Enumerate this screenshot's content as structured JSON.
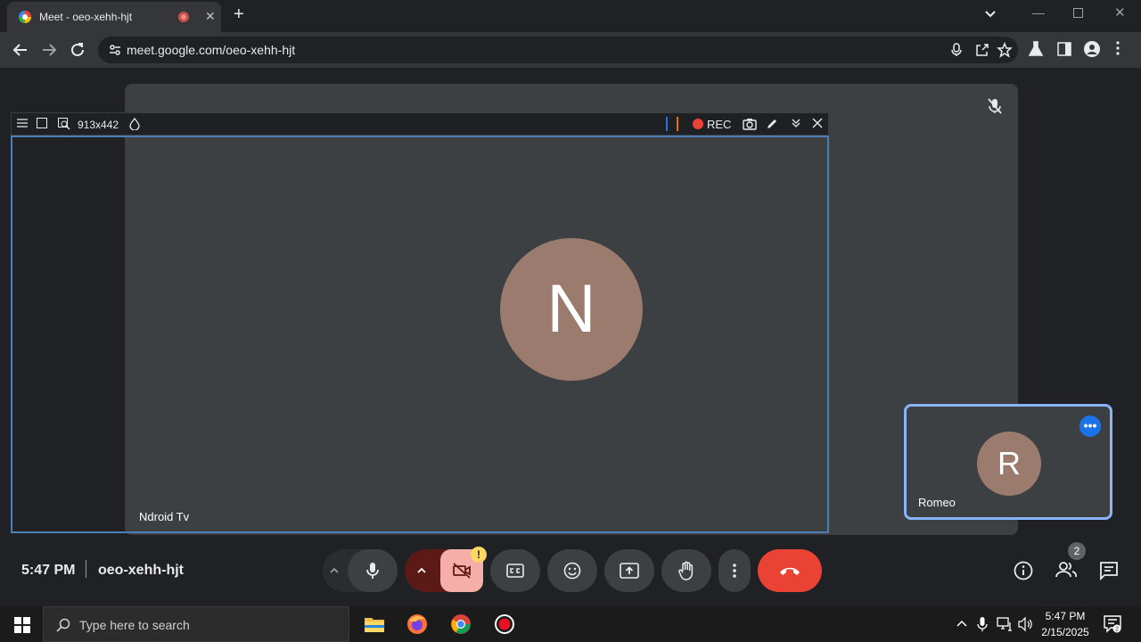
{
  "browser": {
    "tab_title": "Meet - oeo-xehh-hjt",
    "url": "meet.google.com/oeo-xehh-hjt",
    "new_tab_symbol": "+",
    "tab_close_symbol": "✕"
  },
  "recorder": {
    "capture_size": "913x442",
    "rec_label": "REC"
  },
  "meeting": {
    "main_participant": {
      "initial": "N",
      "name": "Ndroid Tv"
    },
    "self_participant": {
      "initial": "R",
      "name": "Romeo"
    },
    "time": "5:47 PM",
    "code": "oeo-xehh-hjt",
    "people_count": "2",
    "camera_warning": "!",
    "more_dots": "•••"
  },
  "taskbar": {
    "search_placeholder": "Type here to search",
    "clock_time": "5:47 PM",
    "clock_date": "2/15/2025"
  },
  "colors": {
    "leave_button": "#ea4335",
    "camera_off": "#f6aea9",
    "self_tile_border": "#8ab4f8",
    "avatar": "#9c7b6f"
  }
}
